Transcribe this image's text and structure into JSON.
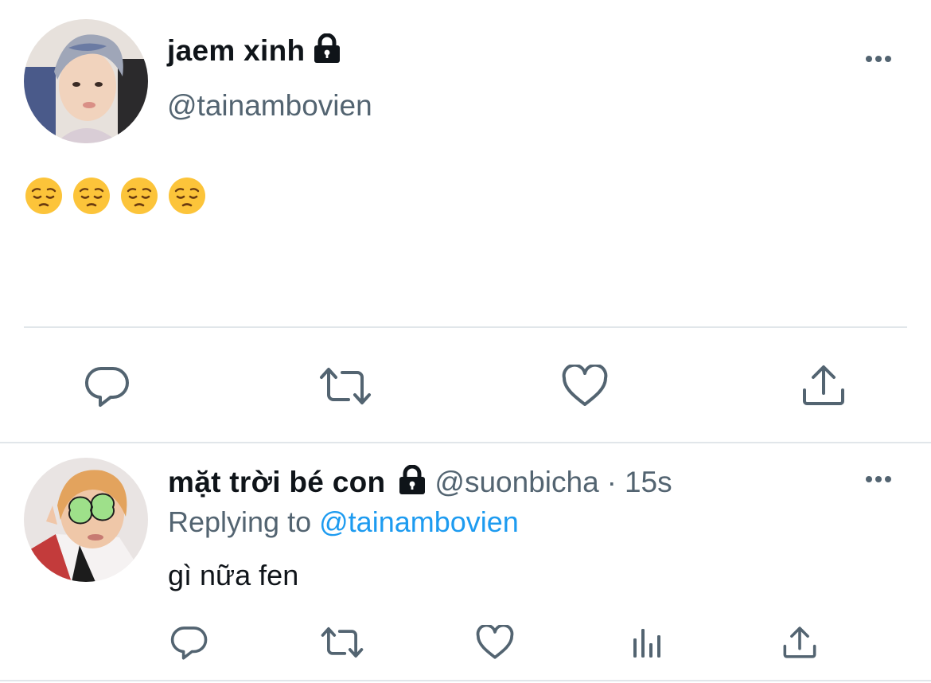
{
  "colors": {
    "text": "#0f1419",
    "secondary": "#536471",
    "accent": "#1d9bf0",
    "divider": "#e1e6ea"
  },
  "main_tweet": {
    "display_name": "jaem xinh",
    "handle": "@tainambovien",
    "protected_icon": "lock-icon",
    "content_emojis": [
      "😔",
      "😔",
      "😔",
      "😔"
    ],
    "actions": [
      "reply-icon",
      "retweet-icon",
      "like-icon",
      "share-icon"
    ]
  },
  "reply_tweet": {
    "display_name": "mặt trời bé con",
    "handle": "@suonbicha",
    "separator": "·",
    "time": "15s",
    "replying_label": "Replying to",
    "replying_to": "@tainambovien",
    "text": "gì nữa fen",
    "actions": [
      "reply-icon",
      "retweet-icon",
      "like-icon",
      "analytics-icon",
      "share-icon"
    ]
  }
}
